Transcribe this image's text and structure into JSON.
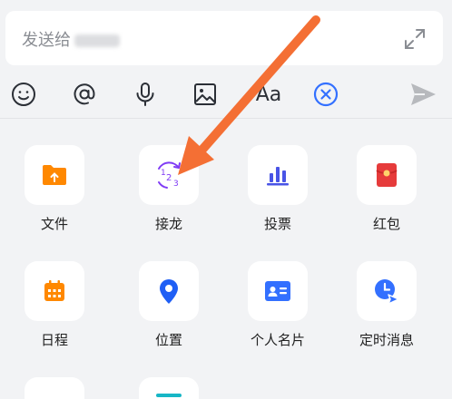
{
  "input": {
    "placeholder_text": "发送给",
    "expand_icon": "expand-icon"
  },
  "toolbar": {
    "icons": [
      "emoji-icon",
      "mention-icon",
      "microphone-icon",
      "image-icon",
      "text-format-icon",
      "clear-icon",
      "send-icon"
    ],
    "text_format_label": "Aa",
    "accent_color": "#3370ff"
  },
  "panel": {
    "items": [
      {
        "label": "文件",
        "icon": "file-upload-icon",
        "color": "#ff8800"
      },
      {
        "label": "接龙",
        "icon": "relay-icon",
        "color": "#7f3bf5"
      },
      {
        "label": "投票",
        "icon": "vote-icon",
        "color": "#4954e6"
      },
      {
        "label": "红包",
        "icon": "red-packet-icon",
        "color": "#e63b3b"
      },
      {
        "label": "日程",
        "icon": "calendar-icon",
        "color": "#ff8800"
      },
      {
        "label": "位置",
        "icon": "location-icon",
        "color": "#1f5ff5"
      },
      {
        "label": "个人名片",
        "icon": "contact-card-icon",
        "color": "#3370ff"
      },
      {
        "label": "定时消息",
        "icon": "scheduled-message-icon",
        "color": "#3370ff"
      }
    ]
  },
  "annotation": {
    "arrow_color": "#f46f34"
  }
}
